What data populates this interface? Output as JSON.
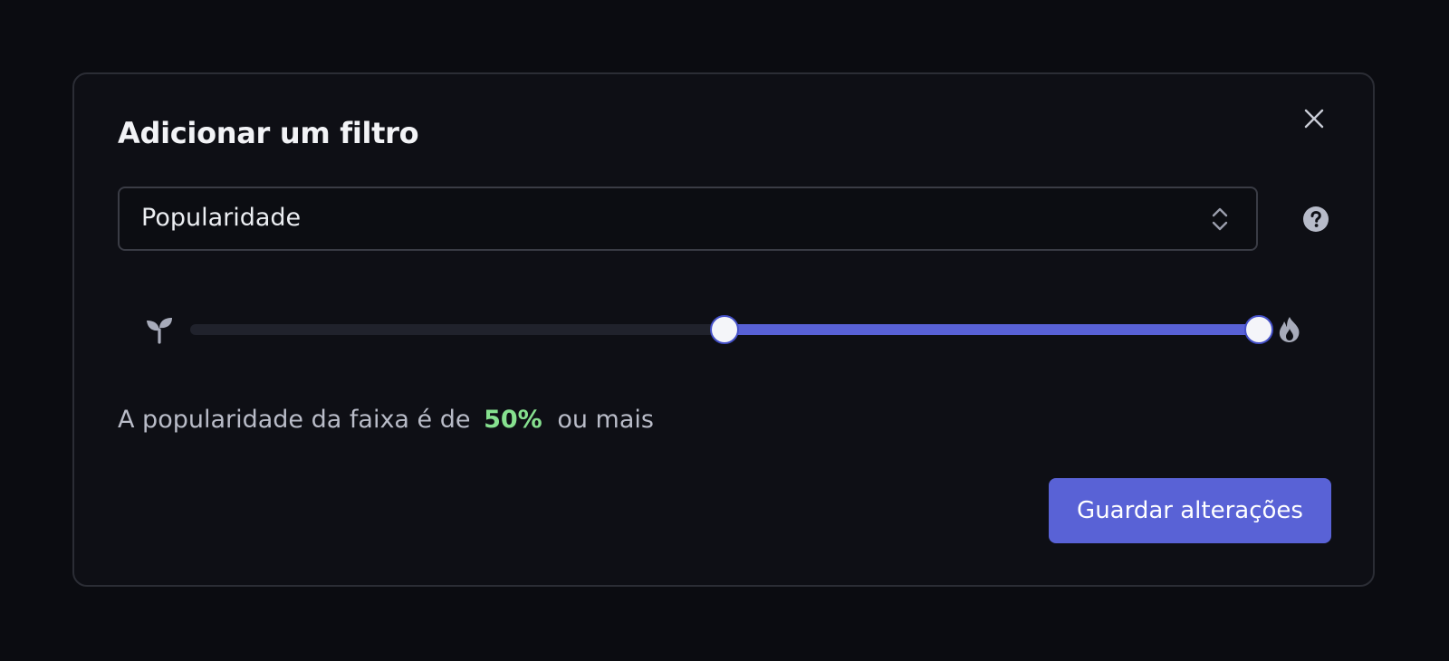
{
  "modal": {
    "title": "Adicionar um filtro",
    "close_icon": "close-icon"
  },
  "filter_select": {
    "value": "Popularidade",
    "chevron_icon": "chevron-updown-icon",
    "help_icon": "question-circle-icon"
  },
  "slider": {
    "min_icon": "sprout-icon",
    "max_icon": "fire-icon",
    "range_low_percent": 50,
    "range_high_percent": 100,
    "accent_color": "#5861d6",
    "track_color": "#20222c"
  },
  "summary": {
    "prefix": "A popularidade da faixa é de",
    "value": "50%",
    "suffix": "ou mais",
    "value_color": "#86e08f"
  },
  "actions": {
    "save_label": "Guardar alterações",
    "save_color": "#5962d6"
  }
}
